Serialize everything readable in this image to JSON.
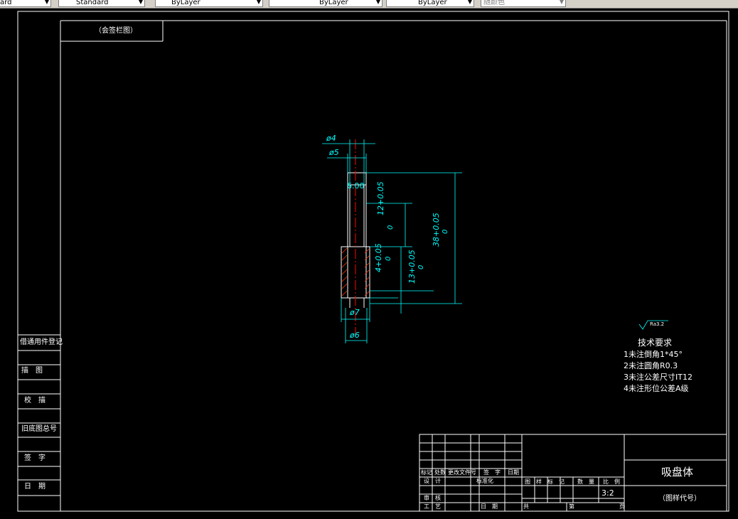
{
  "toolbar": {
    "items": [
      {
        "label": "ard",
        "type": "combo"
      },
      {
        "label": "Standard",
        "type": "combo"
      },
      {
        "label": "ByLayer",
        "type": "combo"
      },
      {
        "label": "ByLayer",
        "type": "combo"
      },
      {
        "label": "ByLayer",
        "type": "combo"
      },
      {
        "label": "随颜色",
        "type": "combo"
      }
    ]
  },
  "drawing": {
    "top_label": "（会签栏图）",
    "dimensions": {
      "d4": "ø4",
      "d5": "ø5",
      "d7": "ø7",
      "d6": "ø6",
      "c6": "6.00",
      "dim12": "12+0.05",
      "dim12_low": "0",
      "dim38": "38+0.05",
      "dim38_low": "0",
      "dim4": "4+0.05",
      "dim4_low": "0",
      "dim13": "13+0.05",
      "dim13_low": "0"
    },
    "surface_finish": "Ra3.2",
    "tech_requirements": {
      "title": "技术要求",
      "items": [
        "1未注倒角1*45°",
        "2未注圆角R0.3",
        "3未注公差尺寸IT12",
        "4未注形位公差A级"
      ]
    },
    "left_block": [
      "借通用件登记",
      "描　图",
      "校　描",
      "旧底图总号",
      "签　字",
      "日　期"
    ],
    "title_block": {
      "part_name": "吸盘体",
      "drawing_code": "（图样代号）",
      "scale": "3:2",
      "row_labels": [
        "标记",
        "处数",
        "更改文件号",
        "签　字",
        "日期"
      ],
      "designer": "设　计",
      "standard": "标准化",
      "reviewer": "审　核",
      "process": "工　艺",
      "date": "日　期",
      "stage_labels": [
        "图　样　标　记",
        "数　量",
        "比　例"
      ],
      "sheet_total": "共",
      "sheet_no": "第",
      "page": "页"
    }
  },
  "colors": {
    "background": "#000000",
    "border": "#ffffff",
    "dimension": "#00ffff",
    "centerline": "#ff0000",
    "part": "#ffffff",
    "hatch": "#ff3300"
  }
}
